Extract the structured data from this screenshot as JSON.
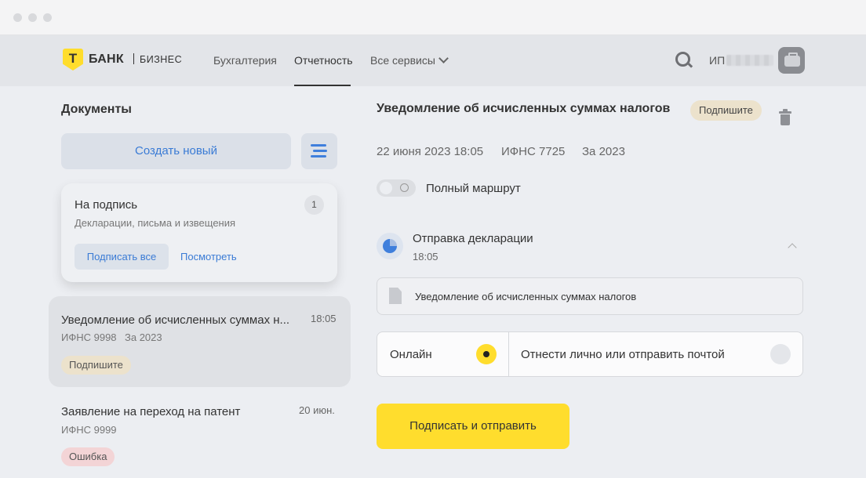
{
  "header": {
    "logo_letter": "Т",
    "logo_bank": "БАНК",
    "logo_business": "БИЗНЕС",
    "nav": [
      "Бухгалтерия",
      "Отчетность",
      "Все сервисы"
    ],
    "active_nav": "Отчетность",
    "user_prefix": "ИП"
  },
  "sidebar": {
    "title": "Документы",
    "create_label": "Создать новый",
    "pending_card": {
      "title": "На подпись",
      "subtitle": "Декларации, письма и извещения",
      "count": "1",
      "sign_all_label": "Подписать все",
      "view_label": "Посмотреть"
    },
    "documents": [
      {
        "title": "Уведомление об исчисленных суммах н...",
        "time": "18:05",
        "agency": "ИФНС 9998",
        "period": "За 2023",
        "status": "Подпишите"
      },
      {
        "title": "Заявление на переход на патент",
        "time": "20 июн.",
        "agency": "ИФНС 9999",
        "period": "",
        "status": "Ошибка"
      }
    ]
  },
  "detail": {
    "title": "Уведомление об исчисленных суммах налогов",
    "status": "Подпишите",
    "date": "22 июня 2023 18:05",
    "agency": "ИФНС 7725",
    "period": "За 2023",
    "route_toggle_label": "Полный маршрут",
    "route_toggle_on": false,
    "step": {
      "title": "Отправка декларации",
      "time": "18:05"
    },
    "file_name": "Уведомление об исчисленных суммах налогов",
    "options": [
      {
        "label": "Онлайн",
        "selected": true
      },
      {
        "label": "Отнести лично или отправить почтой",
        "selected": false
      }
    ],
    "submit_label": "Подписать и отправить"
  },
  "colors": {
    "accent": "#ffdd2d",
    "link": "#3a7bd5",
    "sign_badge": "#ece2cc",
    "error_badge": "#f3d4d6"
  }
}
